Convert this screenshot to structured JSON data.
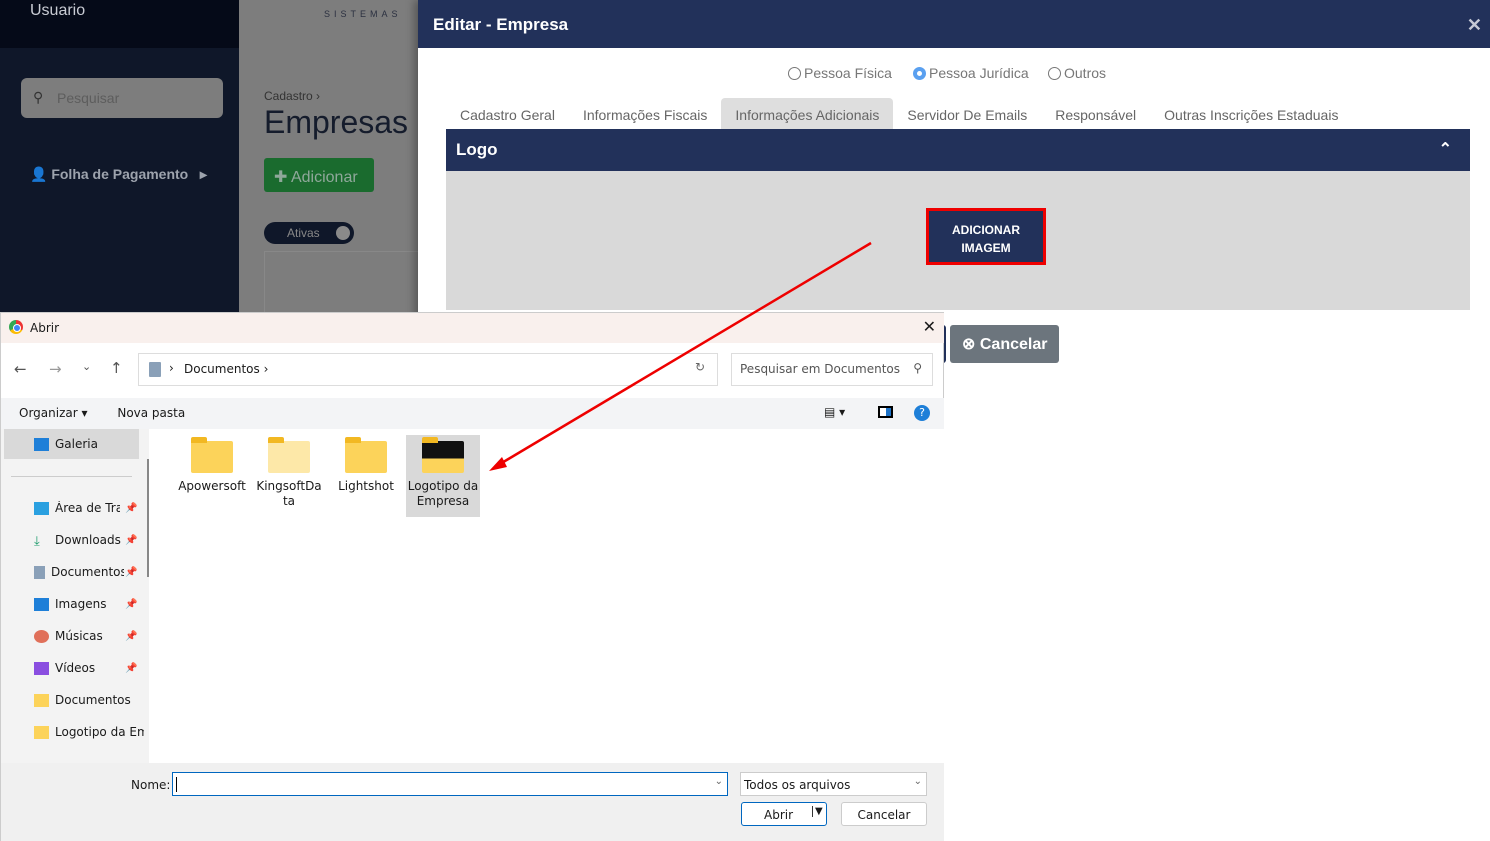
{
  "sidebar": {
    "user": "Usuario",
    "search_placeholder": "Pesquisar",
    "items": [
      {
        "label": "Folha de Pagamento"
      }
    ]
  },
  "page": {
    "logo_text": "SISTEMAS",
    "breadcrumb": "Cadastro",
    "title": "Empresas",
    "add_label": "Adicionar",
    "toggle_label": "Ativas"
  },
  "modal": {
    "title": "Editar - Empresa",
    "person_types": [
      {
        "label": "Pessoa Física",
        "selected": false
      },
      {
        "label": "Pessoa Jurídica",
        "selected": true
      },
      {
        "label": "Outros",
        "selected": false
      }
    ],
    "tabs": [
      {
        "label": "Cadastro Geral"
      },
      {
        "label": "Informações Fiscais"
      },
      {
        "label": "Informações Adicionais",
        "active": true
      },
      {
        "label": "Servidor De Emails"
      },
      {
        "label": "Responsável"
      },
      {
        "label": "Outras Inscrições Estaduais"
      }
    ],
    "section_title": "Logo",
    "add_image_label": "ADICIONAR IMAGEM",
    "cancel_label": "Cancelar",
    "colors": {
      "header": "#22315a",
      "highlight": "#e00000"
    }
  },
  "dialog": {
    "title": "Abrir",
    "path": "Documentos",
    "search_placeholder": "Pesquisar em Documentos",
    "organize_label": "Organizar",
    "new_folder_label": "Nova pasta",
    "nav": [
      {
        "label": "Galeria",
        "icon": "gallery-icon"
      },
      {
        "label": "Área de Trabalho",
        "icon": "desktop-icon",
        "pinned": true
      },
      {
        "label": "Downloads",
        "icon": "download-icon",
        "pinned": true
      },
      {
        "label": "Documentos",
        "icon": "document-icon",
        "pinned": true
      },
      {
        "label": "Imagens",
        "icon": "image-icon",
        "pinned": true
      },
      {
        "label": "Músicas",
        "icon": "music-icon",
        "pinned": true
      },
      {
        "label": "Vídeos",
        "icon": "video-icon",
        "pinned": true
      },
      {
        "label": "Documentos",
        "icon": "folder-icon"
      },
      {
        "label": "Logotipo da Empresa",
        "icon": "folder-icon"
      }
    ],
    "files": [
      {
        "name": "Apowersoft"
      },
      {
        "name": "KingsoftData"
      },
      {
        "name": "Lightshot"
      },
      {
        "name": "Logotipo da Empresa",
        "selected": true
      }
    ],
    "name_label": "Nome:",
    "name_value": "",
    "file_type": "Todos os arquivos",
    "open_label": "Abrir",
    "cancel_label": "Cancelar"
  }
}
